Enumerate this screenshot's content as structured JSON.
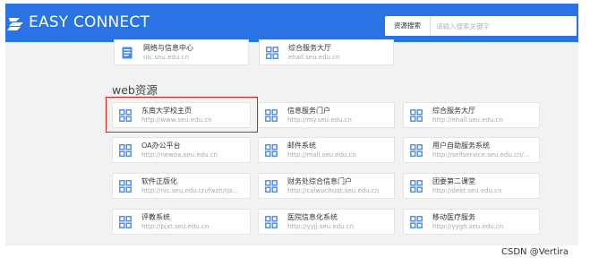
{
  "header": {
    "brand": "EASY CONNECT",
    "search_scope": "资源搜索",
    "search_placeholder": "请输入搜索关键字"
  },
  "top_resources": [
    {
      "title": "网络与信息中心",
      "url": "nic.seu.edu.cn",
      "icon": "document-icon"
    },
    {
      "title": "综合服务大厅",
      "url": "ehall.seu.edu.cn",
      "icon": "grid-icon"
    }
  ],
  "web_section": {
    "title": "web资源",
    "rows": [
      [
        {
          "title": "东南大学校主页",
          "url": "http://www.seu.edu.cn"
        },
        {
          "title": "信息服务门户",
          "url": "http://my.seu.edu.cn"
        },
        {
          "title": "综合服务大厅",
          "url": "http://ehall.seu.edu.cn"
        }
      ],
      [
        {
          "title": "OA办公平台",
          "url": "http://newoa.seu.edu.cn"
        },
        {
          "title": "邮件系统",
          "url": "http://mail.seu.edu.cn"
        },
        {
          "title": "用户自助服务系统",
          "url": "http://selfservice.seu.edu.cn/..."
        }
      ],
      [
        {
          "title": "软件正版化",
          "url": "http://nic.seu.edu.cn/fwzn/rjz..."
        },
        {
          "title": "财务处综合信息门户",
          "url": "http://caiwuchuqt.seu.edu.cn"
        },
        {
          "title": "团委第二课堂",
          "url": "http://dekt.seu.edu.cn"
        }
      ],
      [
        {
          "title": "评教系统",
          "url": "http://pjxt.seu.edu.cn"
        },
        {
          "title": "医院信息化系统",
          "url": "http://yyjj.seu.edu.cn"
        },
        {
          "title": "移动医疗服务",
          "url": "http://yygh.seu.edu.cn"
        }
      ]
    ]
  },
  "watermark": "CSDN @Vertira",
  "colors": {
    "header_bg": "#2a73e4",
    "content_bg": "#f2f2f2",
    "icon_blue": "#3d7fe0",
    "highlight": "#e02020"
  }
}
